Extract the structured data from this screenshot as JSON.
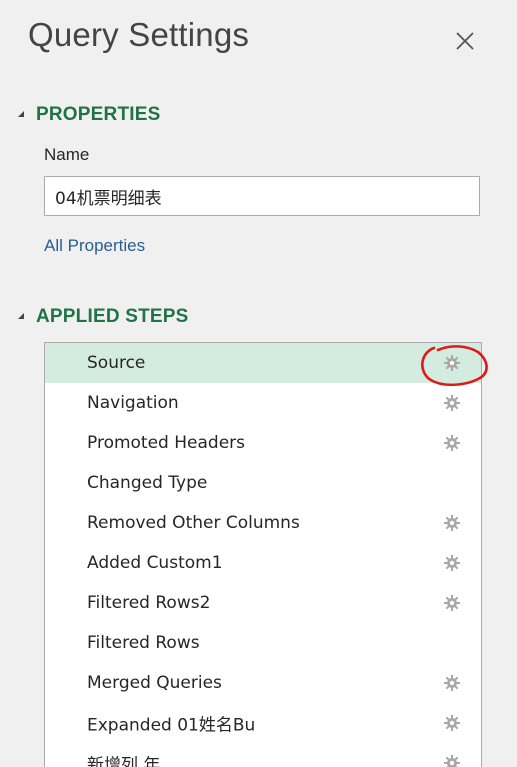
{
  "pane": {
    "title": "Query Settings",
    "close_icon": "close-icon"
  },
  "properties": {
    "header": "PROPERTIES",
    "name_label": "Name",
    "name_value": "04机票明细表",
    "all_properties_link": "All Properties"
  },
  "applied_steps": {
    "header": "APPLIED STEPS",
    "items": [
      {
        "label": "Source",
        "has_settings": true,
        "selected": true
      },
      {
        "label": "Navigation",
        "has_settings": true,
        "selected": false
      },
      {
        "label": "Promoted Headers",
        "has_settings": true,
        "selected": false
      },
      {
        "label": "Changed Type",
        "has_settings": false,
        "selected": false
      },
      {
        "label": "Removed Other Columns",
        "has_settings": true,
        "selected": false
      },
      {
        "label": "Added Custom1",
        "has_settings": true,
        "selected": false
      },
      {
        "label": "Filtered Rows2",
        "has_settings": true,
        "selected": false
      },
      {
        "label": "Filtered Rows",
        "has_settings": false,
        "selected": false
      },
      {
        "label": "Merged Queries",
        "has_settings": true,
        "selected": false
      },
      {
        "label": "Expanded 01姓名Bu",
        "has_settings": true,
        "selected": false
      },
      {
        "label": "新增列 年",
        "has_settings": true,
        "selected": false
      }
    ]
  },
  "colors": {
    "section_header": "#217346",
    "selected_row": "#d3ecdf",
    "link": "#2a5d8f",
    "annotation_circle": "#e01818"
  }
}
